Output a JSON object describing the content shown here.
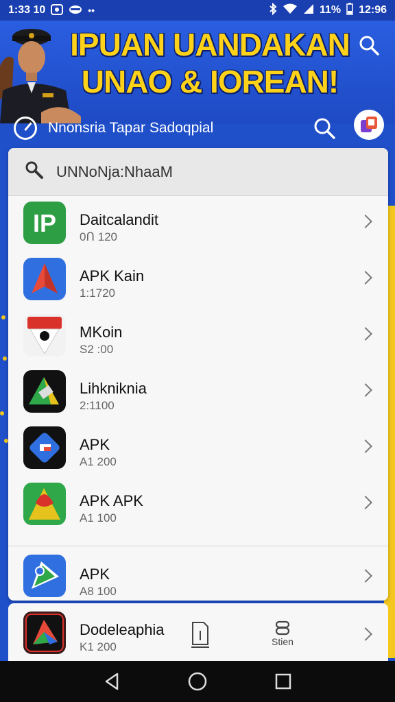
{
  "status_bar": {
    "time": "1:33 10",
    "battery_text": "11%",
    "signal_text": "12:96"
  },
  "hero": {
    "title_line1": "IPUAN UANDAKAN",
    "title_line2": "UNAO & IOREAN!"
  },
  "subheader": {
    "title": "Nnonsria Tapar Sadoqpial"
  },
  "search": {
    "value": "UNNoNja:NhaaM"
  },
  "apps": [
    {
      "name": "Daitcalandit",
      "size": "0Ո 120"
    },
    {
      "name": "APK Kain",
      "size": "1:1720"
    },
    {
      "name": "MKoin",
      "size": "S2 :00"
    },
    {
      "name": "Lihkniknia",
      "size": "2:1100"
    },
    {
      "name": "APK",
      "size": "A1 200"
    },
    {
      "name": "APK APK",
      "size": "A1 100"
    },
    {
      "name": "APK",
      "size": "A8 100"
    }
  ],
  "bottom_app": {
    "name": "Dodeleaphia",
    "size": "K1 200",
    "action_label": "Stien"
  },
  "colors": {
    "brand_blue": "#1f4fc9",
    "title_yellow": "#ffd21a",
    "accent_yellow": "#f4c81e"
  }
}
